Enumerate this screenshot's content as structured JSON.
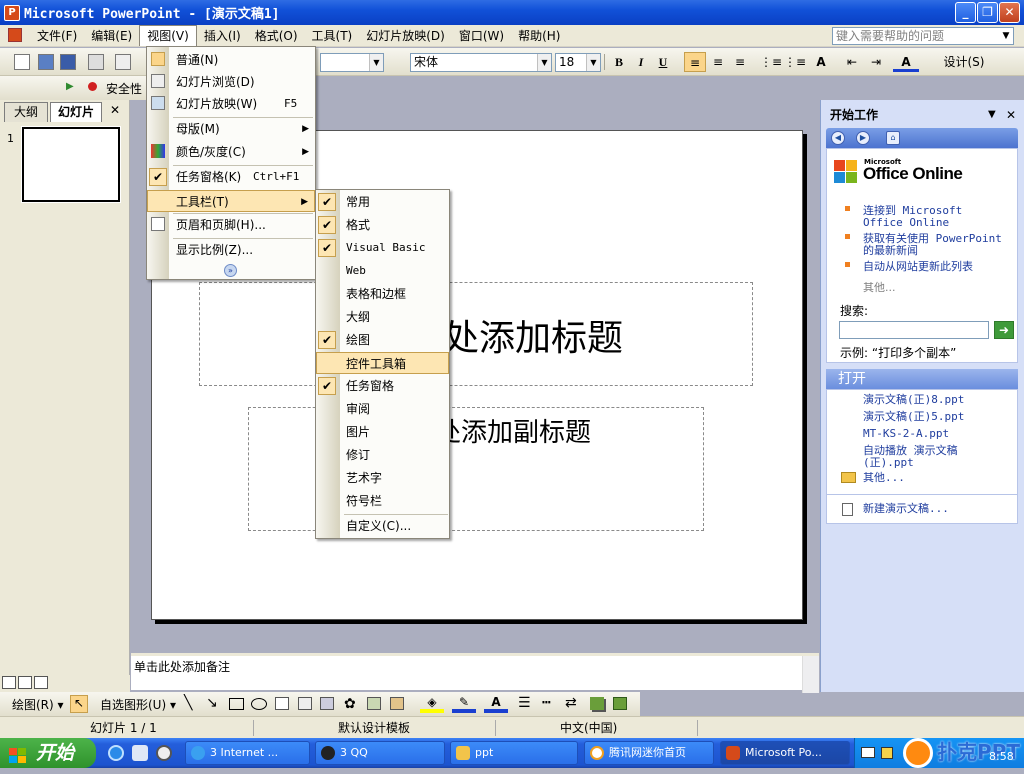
{
  "window": {
    "title": "Microsoft PowerPoint - [演示文稿1]"
  },
  "menubar": {
    "items": [
      "文件(F)",
      "编辑(E)",
      "视图(V)",
      "插入(I)",
      "格式(O)",
      "工具(T)",
      "幻灯片放映(D)",
      "窗口(W)",
      "帮助(H)"
    ],
    "help_placeholder": "键入需要帮助的问题"
  },
  "toolbar": {
    "font_name": "宋体",
    "font_size": "18",
    "bold": "B",
    "italic": "I",
    "underline": "U",
    "design_label": "设计(S)",
    "security_label": "安全性"
  },
  "outline_tabs": {
    "outline": "大纲",
    "slides": "幻灯片"
  },
  "thumbnail": {
    "number": "1"
  },
  "view_menu": {
    "items": [
      {
        "label": "普通(N)",
        "shortcut": ""
      },
      {
        "label": "幻灯片浏览(D)",
        "shortcut": ""
      },
      {
        "label": "幻灯片放映(W)",
        "shortcut": "F5"
      },
      {
        "label": "母版(M)",
        "shortcut": ""
      },
      {
        "label": "颜色/灰度(C)",
        "shortcut": ""
      },
      {
        "label": "任务窗格(K)",
        "shortcut": "Ctrl+F1"
      },
      {
        "label": "工具栏(T)",
        "shortcut": ""
      },
      {
        "label": "页眉和页脚(H)...",
        "shortcut": ""
      },
      {
        "label": "显示比例(Z)...",
        "shortcut": ""
      }
    ]
  },
  "toolbar_menu": {
    "items": [
      {
        "label": "常用",
        "checked": true
      },
      {
        "label": "格式",
        "checked": true
      },
      {
        "label": "Visual Basic",
        "checked": true
      },
      {
        "label": "Web",
        "checked": false
      },
      {
        "label": "表格和边框",
        "checked": false
      },
      {
        "label": "大纲",
        "checked": false
      },
      {
        "label": "绘图",
        "checked": true
      },
      {
        "label": "控件工具箱",
        "checked": false
      },
      {
        "label": "任务窗格",
        "checked": true
      },
      {
        "label": "审阅",
        "checked": false
      },
      {
        "label": "图片",
        "checked": false
      },
      {
        "label": "修订",
        "checked": false
      },
      {
        "label": "艺术字",
        "checked": false
      },
      {
        "label": "符号栏",
        "checked": false
      },
      {
        "label": "自定义(C)...",
        "checked": false
      }
    ]
  },
  "slide": {
    "title_placeholder": "处添加标题",
    "subtitle_placeholder": "处添加副标题"
  },
  "notes": {
    "placeholder": "单击此处添加备注"
  },
  "taskpane": {
    "title": "开始工作",
    "logo_ms": "Microsoft",
    "logo_text": "Office Online",
    "links": [
      "连接到 Microsoft Office Online",
      "获取有关使用 PowerPoint 的最新新闻",
      "自动从网站更新此列表"
    ],
    "more": "其他...",
    "search_label": "搜索:",
    "example": "示例: “打印多个副本”",
    "open_header": "打开",
    "files": [
      "演示文稿(正)8.ppt",
      "演示文稿(正)5.ppt",
      "MT-KS-2-A.ppt",
      "自动播放 演示文稿(正).ppt"
    ],
    "open_more": "其他...",
    "new_label": "新建演示文稿..."
  },
  "drawbar": {
    "draw_label": "绘图(R)",
    "autoshape_label": "自选图形(U)"
  },
  "status": {
    "slide_info": "幻灯片 1 / 1",
    "template": "默认设计模板",
    "language": "中文(中国)"
  },
  "taskbar": {
    "start_label": "开始",
    "buttons": [
      "3 Internet ...",
      "3 QQ",
      "ppt",
      "腾讯网迷你首页",
      "Microsoft Po..."
    ],
    "clock": "8:58",
    "watermark": "扑克PPT"
  }
}
